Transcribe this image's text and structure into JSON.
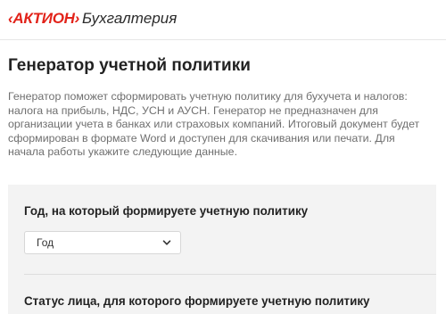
{
  "header": {
    "logo_brand": "‹АКТИОН›",
    "logo_product": "Бухгалтерия"
  },
  "page": {
    "title": "Генератор учетной политики",
    "intro": "Генератор поможет сформировать учетную политику для бухучета и налогов: налога на прибыль, НДС, УСН и АУСН. Генератор не предназначен для организации учета в банках или страховых компаний. Итоговый документ будет сформирован в формате Word и доступен для скачивания или печати. Для начала работы укажите следующие данные."
  },
  "form": {
    "year_label": "Год, на который формируете учетную политику",
    "year_select_value": "Год",
    "status_label": "Статус лица, для которого формируете учетную политику"
  },
  "colors": {
    "brand": "#e2231a",
    "panel": "#f3f3f3"
  }
}
